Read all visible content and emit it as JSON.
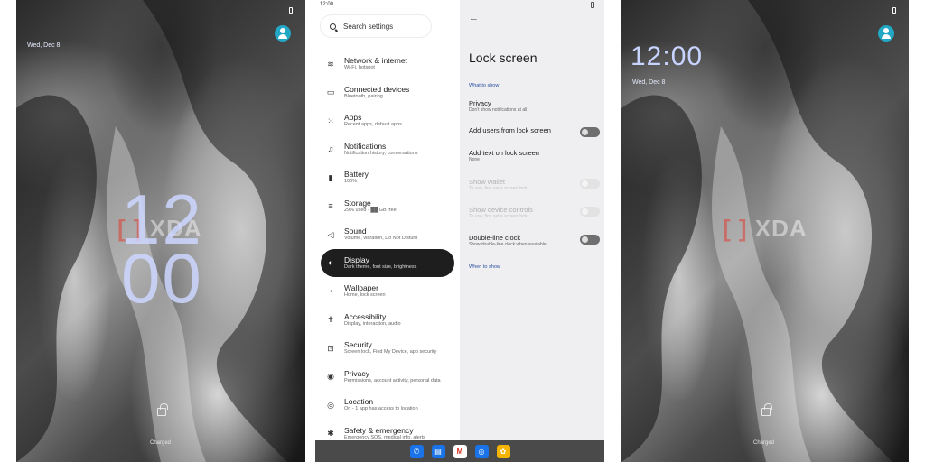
{
  "left_phone": {
    "date": "Wed, Dec 8",
    "clock_line1": "12",
    "clock_line2": "00",
    "charged": "Charged",
    "watermark": "XDA"
  },
  "settings": {
    "status_time": "12:00",
    "search_placeholder": "Search settings",
    "menu": [
      {
        "title": "Network & internet",
        "sub": "Wi-Fi, hotspot",
        "icon": "wifi-icon",
        "glyph": "≋"
      },
      {
        "title": "Connected devices",
        "sub": "Bluetooth, pairing",
        "icon": "devices-icon",
        "glyph": "▭"
      },
      {
        "title": "Apps",
        "sub": "Recent apps, default apps",
        "icon": "apps-icon",
        "glyph": "⁙"
      },
      {
        "title": "Notifications",
        "sub": "Notification history, conversations",
        "icon": "bell-icon",
        "glyph": "♫"
      },
      {
        "title": "Battery",
        "sub": "100%",
        "icon": "battery-icon",
        "glyph": "▮"
      },
      {
        "title": "Storage",
        "sub": "29% used - ██ GB free",
        "icon": "storage-icon",
        "glyph": "≡"
      },
      {
        "title": "Sound",
        "sub": "Volume, vibration, Do Not Disturb",
        "icon": "sound-icon",
        "glyph": "◁"
      },
      {
        "title": "Display",
        "sub": "Dark theme, font size, brightness",
        "icon": "display-icon",
        "glyph": "◐"
      },
      {
        "title": "Wallpaper",
        "sub": "Home, lock screen",
        "icon": "palette-icon",
        "glyph": "◔"
      },
      {
        "title": "Accessibility",
        "sub": "Display, interaction, audio",
        "icon": "accessibility-icon",
        "glyph": "✝"
      },
      {
        "title": "Security",
        "sub": "Screen lock, Find My Device, app security",
        "icon": "lock-icon",
        "glyph": "⊡"
      },
      {
        "title": "Privacy",
        "sub": "Permissions, account activity, personal data",
        "icon": "eye-icon",
        "glyph": "◉"
      },
      {
        "title": "Location",
        "sub": "On - 1 app has access to location",
        "icon": "location-icon",
        "glyph": "◎"
      },
      {
        "title": "Safety & emergency",
        "sub": "Emergency SOS, medical info, alerts",
        "icon": "asterisk-icon",
        "glyph": "✱"
      }
    ],
    "lock_screen": {
      "title": "Lock screen",
      "section_what": "What to show",
      "section_when": "When to show",
      "privacy_title": "Privacy",
      "privacy_sub": "Don't show notifications at all",
      "add_users": "Add users from lock screen",
      "add_text_title": "Add text on lock screen",
      "add_text_sub": "None",
      "show_wallet_title": "Show wallet",
      "show_wallet_sub": "To use, first set a screen lock",
      "device_controls_title": "Show device controls",
      "device_controls_sub": "To use, first set a screen lock",
      "double_clock_title": "Double-line clock",
      "double_clock_sub": "Show double-line clock when available"
    },
    "taskbar_apps": [
      {
        "name": "phone-app-icon",
        "glyph": "✆",
        "color": "#1a73e8"
      },
      {
        "name": "messages-app-icon",
        "glyph": "▤",
        "color": "#1a73e8"
      },
      {
        "name": "gmail-app-icon",
        "glyph": "M",
        "color": "#ffffff"
      },
      {
        "name": "chrome-app-icon",
        "glyph": "◎",
        "color": "#1a73e8"
      },
      {
        "name": "photos-app-icon",
        "glyph": "✿",
        "color": "#f4b400"
      }
    ]
  },
  "right_phone": {
    "clock": "12:00",
    "date": "Wed, Dec 8",
    "charged": "Charged",
    "watermark": "XDA"
  },
  "colors": {
    "accent_teal": "#22a7c4",
    "active_menu": "#1e1e1e",
    "section_blue": "#2b4fa0"
  }
}
